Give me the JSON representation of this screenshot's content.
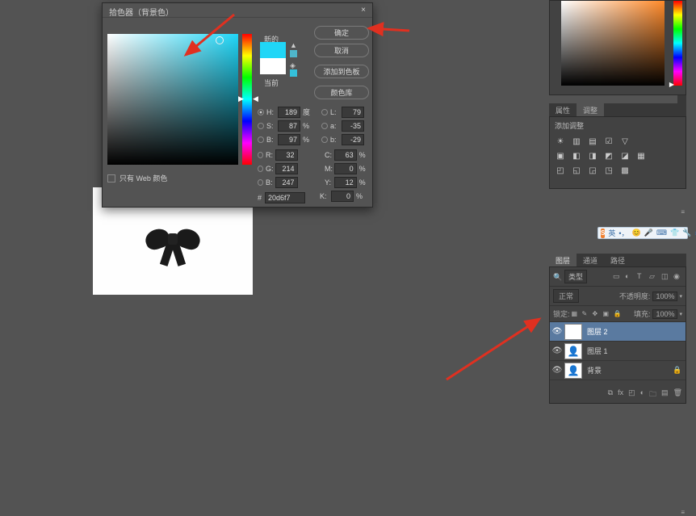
{
  "dialog": {
    "title": "拾色器（背景色）",
    "close": "×",
    "new_label": "新的",
    "current_label": "当前",
    "buttons": {
      "ok": "确定",
      "cancel": "取消",
      "add": "添加到色板",
      "lib": "颜色库"
    },
    "fields": {
      "H": {
        "lbl": "H:",
        "val": "189",
        "unit": "度"
      },
      "S": {
        "lbl": "S:",
        "val": "87",
        "unit": "%"
      },
      "B": {
        "lbl": "B:",
        "val": "97",
        "unit": "%"
      },
      "R": {
        "lbl": "R:",
        "val": "32"
      },
      "G": {
        "lbl": "G:",
        "val": "214"
      },
      "Bb": {
        "lbl": "B:",
        "val": "247"
      },
      "L": {
        "lbl": "L:",
        "val": "79"
      },
      "a": {
        "lbl": "a:",
        "val": "-35"
      },
      "b2": {
        "lbl": "b:",
        "val": "-29"
      },
      "C": {
        "lbl": "C:",
        "val": "63",
        "unit": "%"
      },
      "M": {
        "lbl": "M:",
        "val": "0",
        "unit": "%"
      },
      "Y": {
        "lbl": "Y:",
        "val": "12",
        "unit": "%"
      },
      "K": {
        "lbl": "K:",
        "val": "0",
        "unit": "%"
      }
    },
    "hex_lbl": "#",
    "hex_val": "20d6f7",
    "web_only": "只有 Web 颜色"
  },
  "props": {
    "tab1": "属性",
    "tab2": "调整",
    "add_adj": "添加调整"
  },
  "layers": {
    "tab1": "图层",
    "tab2": "通道",
    "tab3": "路径",
    "kind": "类型",
    "blend": "正常",
    "opacity_lbl": "不透明度:",
    "opacity_val": "100%",
    "lock_lbl": "锁定:",
    "fill_lbl": "填充:",
    "fill_val": "100%",
    "items": [
      {
        "name": "图层 2"
      },
      {
        "name": "图层 1"
      },
      {
        "name": "背景"
      }
    ]
  },
  "ime": {
    "zh": "英"
  }
}
